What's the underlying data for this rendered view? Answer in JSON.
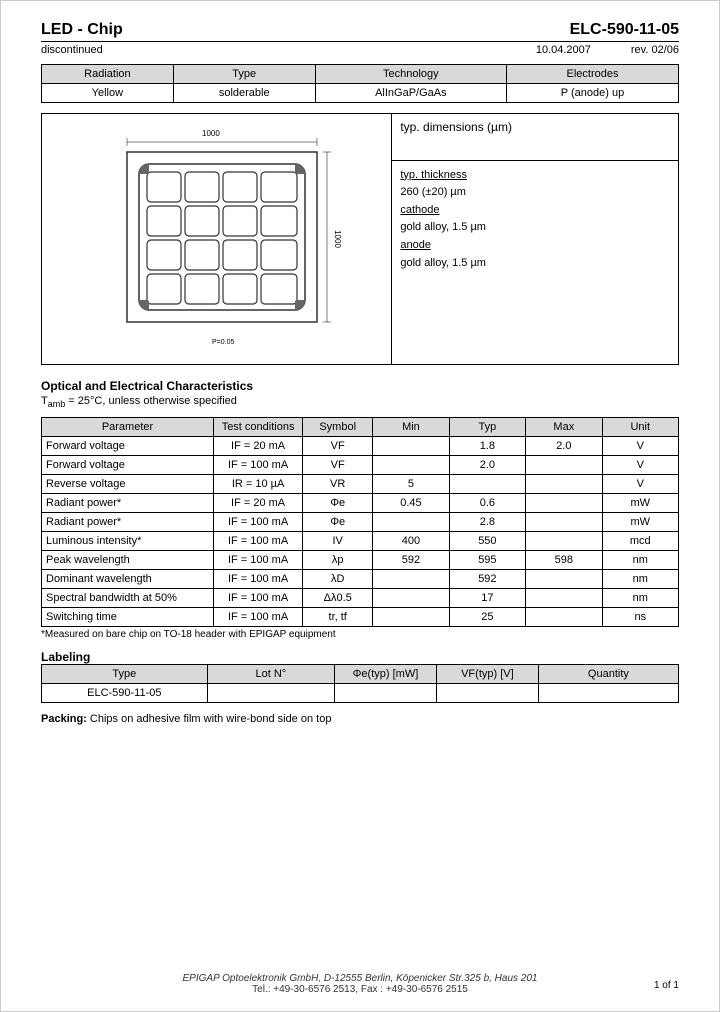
{
  "header": {
    "title": "LED - Chip",
    "part": "ELC-590-11-05",
    "status": "discontinued",
    "date": "10.04.2007",
    "rev": "rev. 02/06"
  },
  "classification": {
    "headers": [
      "Radiation",
      "Type",
      "Technology",
      "Electrodes"
    ],
    "values": [
      "Yellow",
      "solderable",
      "AlInGaP/GaAs",
      "P (anode) up"
    ]
  },
  "dimensions": {
    "width_label": "1000",
    "height_label": "1000",
    "caption": "P=0.05",
    "title": "typ. dimensions (µm)",
    "thickness_label": "typ. thickness",
    "thickness_value": "260 (±20) µm",
    "cathode_label": "cathode",
    "cathode_value": "gold alloy, 1.5 µm",
    "anode_label": "anode",
    "anode_value": "gold alloy, 1.5 µm"
  },
  "optical": {
    "title": "Optical and Electrical Characteristics",
    "subtitle": "Tamb = 25°C, unless otherwise specified",
    "headers": [
      "Parameter",
      "Test conditions",
      "Symbol",
      "Min",
      "Typ",
      "Max",
      "Unit"
    ],
    "rows": [
      [
        "Forward voltage",
        "IF = 20 mA",
        "VF",
        "",
        "1.8",
        "2.0",
        "V"
      ],
      [
        "Forward voltage",
        "IF = 100 mA",
        "VF",
        "",
        "2.0",
        "",
        "V"
      ],
      [
        "Reverse voltage",
        "IR = 10 µA",
        "VR",
        "5",
        "",
        "",
        "V"
      ],
      [
        "Radiant power*",
        "IF = 20 mA",
        "Φe",
        "0.45",
        "0.6",
        "",
        "mW"
      ],
      [
        "Radiant power*",
        "IF = 100 mA",
        "Φe",
        "",
        "2.8",
        "",
        "mW"
      ],
      [
        "Luminous intensity*",
        "IF = 100 mA",
        "IV",
        "400",
        "550",
        "",
        "mcd"
      ],
      [
        "Peak wavelength",
        "IF = 100 mA",
        "λp",
        "592",
        "595",
        "598",
        "nm"
      ],
      [
        "Dominant wavelength",
        "IF = 100 mA",
        "λD",
        "",
        "592",
        "",
        "nm"
      ],
      [
        "Spectral bandwidth at 50%",
        "IF = 100 mA",
        "Δλ0.5",
        "",
        "17",
        "",
        "nm"
      ],
      [
        "Switching time",
        "IF = 100 mA",
        "tr, tf",
        "",
        "25",
        "",
        "ns"
      ]
    ],
    "footnote": "*Measured on bare chip on TO-18 header with EPIGAP equipment"
  },
  "labeling": {
    "title": "Labeling",
    "headers": [
      "Type",
      "Lot N°",
      "Φe(typ) [mW]",
      "VF(typ) [V]",
      "Quantity"
    ],
    "row": [
      "ELC-590-11-05",
      "",
      "",
      "",
      ""
    ]
  },
  "packing": {
    "label": "Packing:",
    "text": "Chips on adhesive film with wire-bond side on top"
  },
  "footer": {
    "line1": "EPIGAP Optoelektronik GmbH, D-12555 Berlin, Köpenicker Str.325 b, Haus 201",
    "line2": "Tel.: +49-30-6576 2513, Fax : +49-30-6576 2515",
    "page": "1 of 1"
  }
}
